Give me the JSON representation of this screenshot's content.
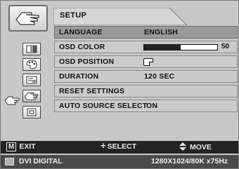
{
  "header": {
    "title": "SETUP"
  },
  "menu": [
    {
      "label": "LANGUAGE",
      "value": "ENGLISH",
      "selected": true
    },
    {
      "label": "OSD COLOR",
      "level": 50,
      "level_text": "50"
    },
    {
      "label": "OSD POSITION",
      "icon": "position-corner-icon"
    },
    {
      "label": "DURATION",
      "value": "120 SEC"
    },
    {
      "label": "RESET SETTINGS"
    },
    {
      "label": "AUTO SOURCE SELECT",
      "value": "ON"
    }
  ],
  "sidebar": {
    "top_icon": "hand-icon",
    "icons": [
      "brightness-icon",
      "color-icon",
      "image-icon",
      "setup-hand-icon",
      "input-icon"
    ],
    "active_index": 3
  },
  "footer": {
    "exit_key": "M",
    "exit_label": "EXIT",
    "select_label": "SELECT",
    "move_label": "MOVE"
  },
  "status": {
    "source": "DVI DIGITAL",
    "resolution": "1280X1024/80K x75Hz"
  },
  "colors": {
    "panel": "#c8c8c8",
    "selected_row": "#9a9a9a",
    "footer": "#232323"
  }
}
